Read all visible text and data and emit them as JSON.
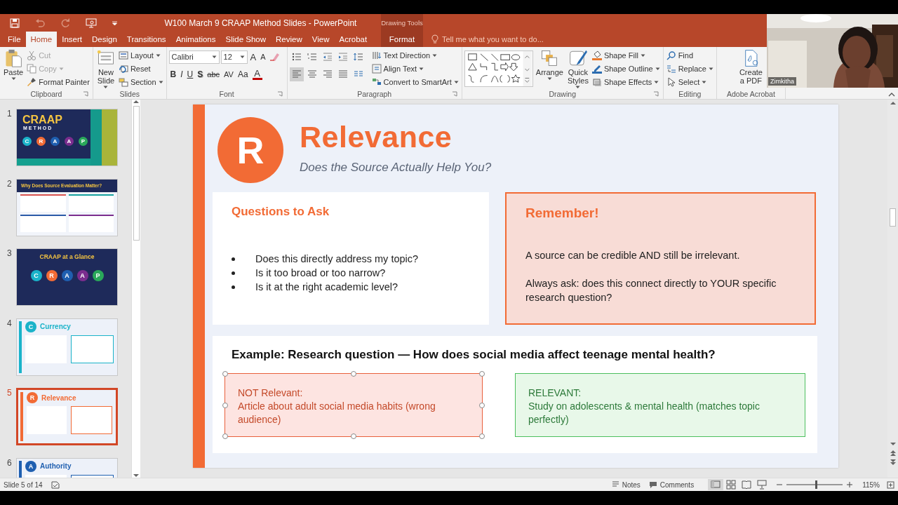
{
  "titlebar": {
    "title": "W100 March 9 CRAAP Method Slides - PowerPoint",
    "context_label": "Drawing Tools"
  },
  "tabs": [
    {
      "label": "File",
      "kind": "normal",
      "selected": false
    },
    {
      "label": "Home",
      "kind": "normal",
      "selected": true
    },
    {
      "label": "Insert",
      "kind": "normal",
      "selected": false
    },
    {
      "label": "Design",
      "kind": "normal",
      "selected": false
    },
    {
      "label": "Transitions",
      "kind": "normal",
      "selected": false
    },
    {
      "label": "Animations",
      "kind": "normal",
      "selected": false
    },
    {
      "label": "Slide Show",
      "kind": "normal",
      "selected": false
    },
    {
      "label": "Review",
      "kind": "normal",
      "selected": false
    },
    {
      "label": "View",
      "kind": "normal",
      "selected": false
    },
    {
      "label": "Acrobat",
      "kind": "normal",
      "selected": false
    },
    {
      "label": "Format",
      "kind": "contextual",
      "selected": false
    }
  ],
  "tell_me": {
    "placeholder": "Tell me what you want to do..."
  },
  "ribbon": [
    {
      "kind": "clipboard",
      "label": "Clipboard",
      "big": [
        {
          "label": "Paste",
          "dropdown": true
        }
      ],
      "small": [
        {
          "label": "Cut",
          "disabled": true,
          "dropdown": false
        },
        {
          "label": "Copy",
          "disabled": true,
          "dropdown": true
        },
        {
          "label": "Format Painter",
          "disabled": false,
          "dropdown": false
        }
      ]
    },
    {
      "kind": "slides",
      "label": "Slides",
      "big": [
        {
          "label": "New\nSlide",
          "dropdown": true
        }
      ],
      "small": [
        {
          "label": "Layout",
          "disabled": false,
          "dropdown": true
        },
        {
          "label": "Reset",
          "disabled": false,
          "dropdown": false
        },
        {
          "label": "Section",
          "disabled": false,
          "dropdown": true
        }
      ]
    },
    {
      "kind": "font",
      "label": "Font",
      "fields": [
        {
          "value": "Calibri"
        },
        {
          "value": "12"
        }
      ],
      "tools_top": [
        {
          "kind": "grow",
          "label": "A"
        },
        {
          "kind": "shrink",
          "label": "A"
        }
      ],
      "tools": [
        {
          "kind": "bold",
          "label": "B"
        },
        {
          "kind": "italic",
          "label": "I"
        },
        {
          "kind": "underline",
          "label": "U"
        },
        {
          "kind": "shadow",
          "label": "S"
        },
        {
          "kind": "strike",
          "label": "abc"
        },
        {
          "kind": "spacing",
          "label": "AV"
        },
        {
          "kind": "case",
          "label": "Aa"
        },
        {
          "kind": "color",
          "label": "A"
        }
      ]
    },
    {
      "kind": "paragraph",
      "label": "Paragraph",
      "align": [
        {
          "selected": true
        },
        {
          "selected": false
        },
        {
          "selected": false
        },
        {
          "selected": false
        }
      ],
      "small": [
        {
          "label": "Text Direction",
          "disabled": false,
          "dropdown": true
        },
        {
          "label": "Align Text",
          "disabled": false,
          "dropdown": true
        },
        {
          "label": "Convert to SmartArt",
          "disabled": false,
          "dropdown": true
        }
      ]
    },
    {
      "kind": "drawing",
      "label": "Drawing",
      "big": [
        {
          "label": "Arrange",
          "dropdown": true
        },
        {
          "label": "Quick\nStyles",
          "dropdown": true
        }
      ],
      "small": [
        {
          "label": "Shape Fill",
          "disabled": false,
          "dropdown": true
        },
        {
          "label": "Shape Outline",
          "disabled": false,
          "dropdown": true
        },
        {
          "label": "Shape Effects",
          "disabled": false,
          "dropdown": true
        }
      ]
    },
    {
      "kind": "editing",
      "label": "Editing",
      "small": [
        {
          "label": "Find",
          "disabled": false,
          "dropdown": false
        },
        {
          "label": "Replace",
          "disabled": false,
          "dropdown": true
        },
        {
          "label": "Select",
          "disabled": false,
          "dropdown": true
        }
      ]
    },
    {
      "kind": "acrobat",
      "label": "Adobe Acrobat",
      "big": [
        {
          "label": "Create\na PDF",
          "dropdown": false
        }
      ]
    }
  ],
  "thumbnails": [
    {
      "number": "1",
      "kind": "title",
      "selected": false,
      "title": "CRAAP",
      "subtitle": "METHOD",
      "letters": [
        {
          "letter": "C",
          "color": "#1ab3c9"
        },
        {
          "letter": "R",
          "color": "#f26b35"
        },
        {
          "letter": "A",
          "color": "#1f5fb0"
        },
        {
          "letter": "A",
          "color": "#7b2d8e"
        },
        {
          "letter": "P",
          "color": "#2aa85a"
        }
      ]
    },
    {
      "number": "2",
      "kind": "grid",
      "selected": false,
      "title": "Why Does Source Evaluation Matter?"
    },
    {
      "number": "3",
      "kind": "glance",
      "selected": false,
      "title": "CRAAP at a Glance",
      "letters": [
        {
          "letter": "C",
          "color": "#1ab3c9"
        },
        {
          "letter": "R",
          "color": "#f26b35"
        },
        {
          "letter": "A",
          "color": "#1f5fb0"
        },
        {
          "letter": "A",
          "color": "#7b2d8e"
        },
        {
          "letter": "P",
          "color": "#2aa85a"
        }
      ]
    },
    {
      "number": "4",
      "kind": "topic",
      "selected": false,
      "letter": "C",
      "title": "Currency",
      "color": "#1ab3c9"
    },
    {
      "number": "5",
      "kind": "topic",
      "selected": true,
      "letter": "R",
      "title": "Relevance",
      "color": "#f26b35"
    },
    {
      "number": "6",
      "kind": "topic",
      "selected": false,
      "letter": "A",
      "title": "Authority",
      "color": "#1f5fb0"
    }
  ],
  "slide": {
    "letter": "R",
    "title": "Relevance",
    "subtitle": "Does the Source Actually Help You?",
    "questions": {
      "heading": "Questions to Ask",
      "items": [
        "Does this directly address my topic?",
        "Is it too broad or too narrow?",
        "Is it at the right academic level?"
      ]
    },
    "remember": {
      "heading": "Remember!",
      "paragraphs": [
        "A source can be credible AND still be irrelevant.",
        "Always ask: does this connect directly to YOUR specific research question?"
      ]
    },
    "example": {
      "heading": "Example: Research question — How does social media affect teenage mental health?",
      "boxes": [
        {
          "kind": "negative",
          "label": "NOT Relevant:",
          "text": "Article about adult social media habits (wrong audience)",
          "selected": true
        },
        {
          "kind": "positive",
          "label": "RELEVANT:",
          "text": "Study on adolescents & mental health (matches topic perfectly)",
          "selected": false
        }
      ]
    }
  },
  "webcam": {
    "name": "Zimkitha"
  },
  "status_bar": {
    "slide_info": "Slide 5 of 14",
    "notes": "Notes",
    "comments": "Comments",
    "views": [
      {
        "selected": true
      },
      {
        "selected": false
      },
      {
        "selected": false
      },
      {
        "selected": false
      }
    ],
    "zoom": {
      "level": 0.52,
      "reading": "115%"
    }
  }
}
